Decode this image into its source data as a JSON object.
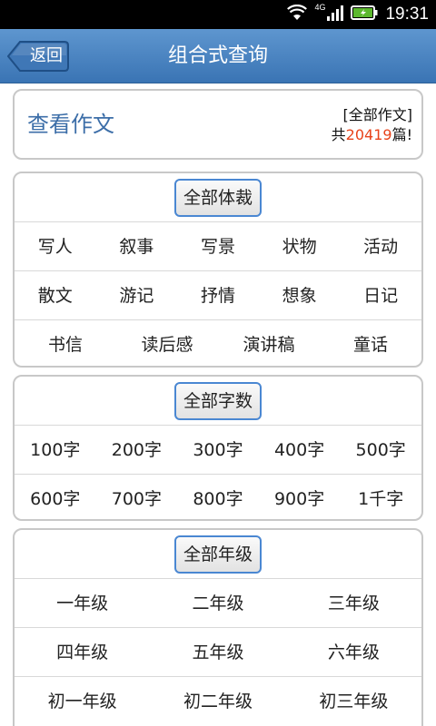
{
  "status_bar": {
    "time": "19:31",
    "network": "4G"
  },
  "header": {
    "back_label": "返回",
    "title": "组合式查询"
  },
  "summary": {
    "title": "查看作文",
    "filter_label": "[全部作文]",
    "count_prefix": "共",
    "count": "20419",
    "count_suffix": "篇!"
  },
  "genre": {
    "all_label": "全部体裁",
    "rows": [
      [
        "写人",
        "叙事",
        "写景",
        "状物",
        "活动"
      ],
      [
        "散文",
        "游记",
        "抒情",
        "想象",
        "日记"
      ],
      [
        "书信",
        "读后感",
        "演讲稿",
        "童话"
      ]
    ]
  },
  "word_count": {
    "all_label": "全部字数",
    "rows": [
      [
        "100字",
        "200字",
        "300字",
        "400字",
        "500字"
      ],
      [
        "600字",
        "700字",
        "800字",
        "900字",
        "1千字"
      ]
    ]
  },
  "grade": {
    "all_label": "全部年级",
    "rows": [
      [
        "一年级",
        "二年级",
        "三年级"
      ],
      [
        "四年级",
        "五年级",
        "六年级"
      ],
      [
        "初一年级",
        "初二年级",
        "初三年级"
      ]
    ]
  },
  "colors": {
    "header_blue": "#3a74b4",
    "accent_orange": "#e8431a",
    "pill_border": "#4a87d2"
  }
}
